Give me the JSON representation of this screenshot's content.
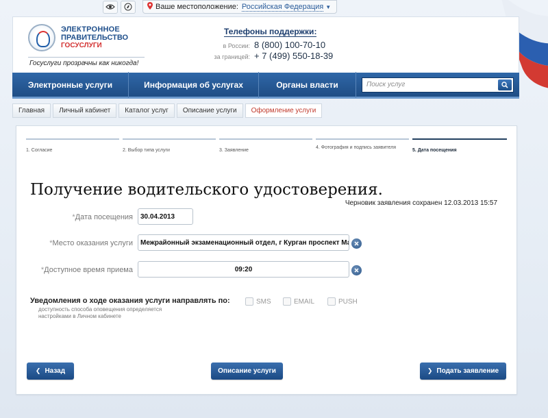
{
  "topbar": {
    "location_label": "Ваше местоположение:",
    "location_value": "Российская Федерация",
    "icons": [
      "accessibility-eye-icon",
      "compass-icon",
      "location-pin-icon",
      "chevron-down-icon"
    ]
  },
  "header": {
    "logo": {
      "line1": "ЭЛЕКТРОННОЕ",
      "line2": "ПРАВИТЕЛЬСТВО",
      "line3": "ГОСУСЛУГИ",
      "slogan": "Госуслуги прозрачны как никогда!"
    },
    "support": {
      "title": "Телефоны поддержки",
      "colon": ":",
      "rows": [
        {
          "label": "в России:",
          "number": "8 (800) 100-70-10"
        },
        {
          "label": "за границей:",
          "number": "+ 7 (499) 550-18-39"
        }
      ]
    }
  },
  "nav": {
    "items": [
      "Электронные услуги",
      "Информация об услугах",
      "Органы власти"
    ],
    "search_placeholder": "Поиск услуг"
  },
  "breadcrumbs": [
    "Главная",
    "Личный кабинет",
    "Каталог услуг",
    "Описание услуги",
    "Оформление услуги"
  ],
  "steps": [
    {
      "label": "1. Согласие",
      "active": false
    },
    {
      "label": "2. Выбор типа услуги",
      "active": false
    },
    {
      "label": "3. Заявление",
      "active": false
    },
    {
      "label": "4. Фотография и подпись заявителя",
      "active": false
    },
    {
      "label": "5. Дата посещения",
      "active": true
    }
  ],
  "form": {
    "title": "Получение водительского удостоверения.",
    "draft_saved": "Черновик заявления сохранен 12.03.2013 15:57",
    "required_mark": "*",
    "fields": [
      {
        "label": "Дата посещения",
        "value": "30.04.2013"
      },
      {
        "label": "Место оказания услуги",
        "value": "Межрайонный экзаменационный отдел,  г Курган проспект Марш"
      },
      {
        "label": "Доступное время приема",
        "value": "09:20"
      }
    ],
    "notify": {
      "title": "Уведомления о ходе оказания услуги направлять по:",
      "hint": "доступность способа оповещения определяется настройками в Личном кабинете",
      "options": [
        {
          "label": "SMS",
          "checked": false
        },
        {
          "label": "EMAIL",
          "checked": false
        },
        {
          "label": "PUSH",
          "checked": false
        }
      ]
    }
  },
  "buttons": {
    "back": "Назад",
    "description": "Описание услуги",
    "submit": "Подать заявление"
  },
  "colors": {
    "nav_blue": "#1f4d85",
    "button_blue": "#1b4a84",
    "active_crumb": "#c0392b",
    "logo_red": "#d32f2f"
  }
}
